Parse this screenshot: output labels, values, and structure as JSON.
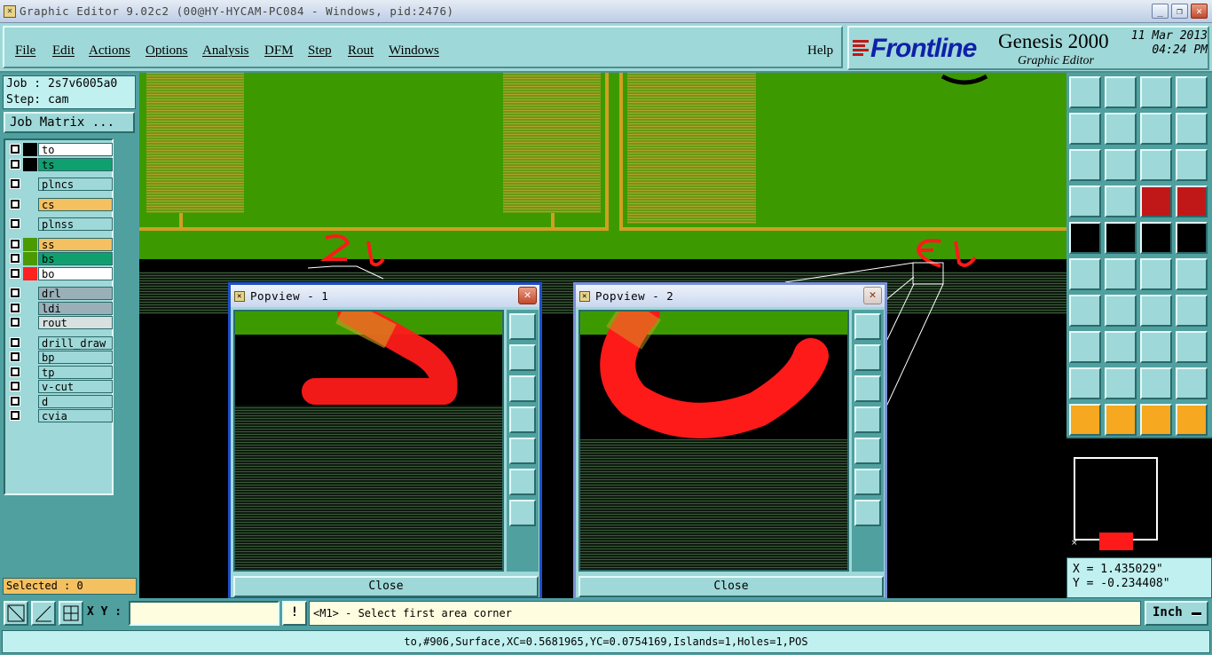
{
  "window": {
    "title": "Graphic Editor 9.02c2 (00@HY-HYCAM-PC084 - Windows, pid:2476)",
    "minimize": "_",
    "maximize": "❐",
    "close": "✕"
  },
  "menu": {
    "items": [
      "File",
      "Edit",
      "Actions",
      "Options",
      "Analysis",
      "DFM",
      "Step",
      "Rout",
      "Windows"
    ],
    "help": "Help"
  },
  "logo": {
    "brand": "Frontline",
    "product": "Genesis 2000",
    "subtitle": "Graphic Editor",
    "date": "11 Mar 2013",
    "time": "04:24 PM"
  },
  "job": {
    "job_line": "Job : 2s7v6005a0",
    "step_line": "Step: cam",
    "matrix_button": "Job Matrix ..."
  },
  "layers": [
    {
      "name": "to",
      "color": "#ffffff",
      "swatch": "#000000",
      "text_color": "#000000"
    },
    {
      "name": "ts",
      "color": "#10a070",
      "swatch": "#000000",
      "text_color": "#000000"
    },
    {
      "name": "plncs",
      "color": "#9fd8d8",
      "swatch": "#9fd8d8",
      "text_color": "#000000"
    },
    {
      "name": "cs",
      "color": "#f5c060",
      "swatch": "#9fd8d8",
      "text_color": "#000000"
    },
    {
      "name": "plnss",
      "color": "#9fd8d8",
      "swatch": "#9fd8d8",
      "text_color": "#000000"
    },
    {
      "name": "ss",
      "color": "#f5c060",
      "swatch": "#4a9a00",
      "text_color": "#000000"
    },
    {
      "name": "bs",
      "color": "#10a070",
      "swatch": "#4a9a00",
      "text_color": "#000000"
    },
    {
      "name": "bo",
      "color": "#ffffff",
      "swatch": "#ff2020",
      "text_color": "#000000"
    },
    {
      "name": "drl",
      "color": "#9ab0b8",
      "swatch": "#9fd8d8",
      "text_color": "#000000"
    },
    {
      "name": "ldi",
      "color": "#9ab0b8",
      "swatch": "#9fd8d8",
      "text_color": "#000000"
    },
    {
      "name": "rout",
      "color": "#d8e0e0",
      "swatch": "#9fd8d8",
      "text_color": "#000000"
    },
    {
      "name": "drill_draw",
      "color": "#9fd8d8",
      "swatch": "#9fd8d8",
      "text_color": "#000000"
    },
    {
      "name": "bp",
      "color": "#9fd8d8",
      "swatch": "#9fd8d8",
      "text_color": "#000000"
    },
    {
      "name": "tp",
      "color": "#9fd8d8",
      "swatch": "#9fd8d8",
      "text_color": "#000000"
    },
    {
      "name": "v-cut",
      "color": "#9fd8d8",
      "swatch": "#9fd8d8",
      "text_color": "#000000"
    },
    {
      "name": "d",
      "color": "#9fd8d8",
      "swatch": "#9fd8d8",
      "text_color": "#000000"
    },
    {
      "name": "cvia",
      "color": "#9fd8d8",
      "swatch": "#9fd8d8",
      "text_color": "#000000"
    }
  ],
  "selected": "Selected : 0",
  "popups": [
    {
      "title": "Popview - 1",
      "close": "Close"
    },
    {
      "title": "Popview - 2",
      "close": "Close"
    }
  ],
  "coords": {
    "x": "X =  1.435029\"",
    "y": "Y = -0.234408\""
  },
  "bottom": {
    "xy_label": "X Y :",
    "xy_value": "",
    "warn": "!",
    "prompt": "<M1> - Select first area corner",
    "units": "Inch",
    "status": "to,#906,Surface,XC=0.5681965,YC=0.0754169,Islands=1,Holes=1,POS"
  },
  "colors": {
    "board_green": "#3c9a00",
    "trace_orange": "#d0a020",
    "silk_red": "#ff1a1a",
    "panel_teal": "#9fd8d8"
  }
}
